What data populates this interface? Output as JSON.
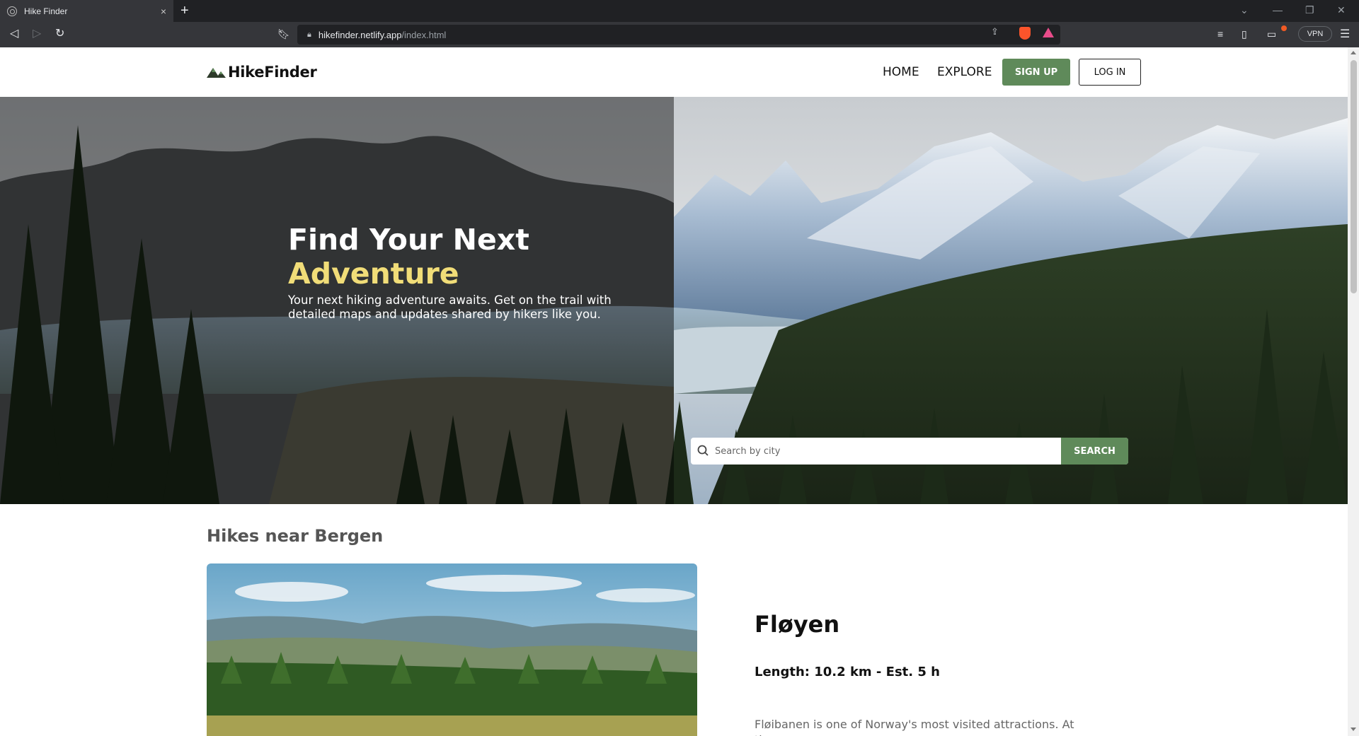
{
  "browser": {
    "tab_title": "Hike Finder",
    "tab_close": "×",
    "new_tab": "+",
    "url_host": "hikefinder.netlify.app",
    "url_path": "/index.html",
    "vpn_label": "VPN"
  },
  "header": {
    "logo_text": "HikeFinder",
    "nav": [
      "HOME",
      "EXPLORE"
    ],
    "signup_label": "SIGN UP",
    "login_label": "LOG IN"
  },
  "hero": {
    "title_line1": "Find Your Next",
    "title_line2": "Adventure",
    "subtitle": "Your next hiking adventure awaits. Get on the trail with detailed maps and updates shared by hikers like you.",
    "search_placeholder": "Search by city",
    "search_button": "SEARCH"
  },
  "results": {
    "section_title": "Hikes near Bergen",
    "hike": {
      "name": "Fløyen",
      "length": "Length: 10.2 km - Est. 5 h",
      "description": "Fløibanen is one of Norway's most visited attractions. At the"
    }
  },
  "colors": {
    "brand_green": "#5f8a5a",
    "accent_yellow": "#f1dd78"
  }
}
